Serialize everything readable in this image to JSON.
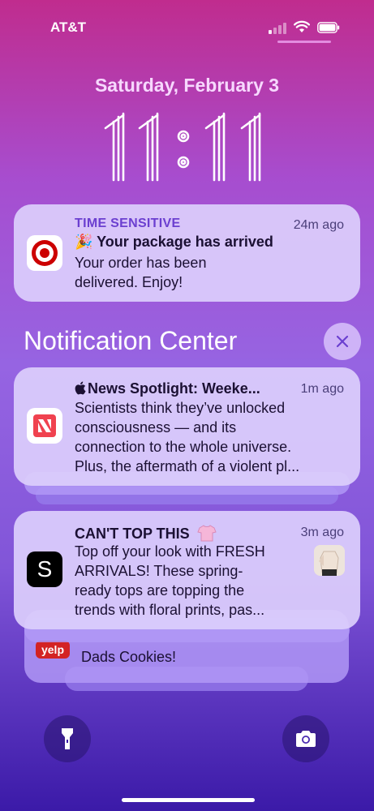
{
  "status": {
    "carrier": "AT&T"
  },
  "lock": {
    "date": "Saturday, February 3"
  },
  "time_sensitive": {
    "label": "TIME SENSITIVE",
    "time": "24m ago",
    "title": "🎉 Your package has arrived",
    "body_line1": "Your order has been",
    "body_line2": "delivered. Enjoy!"
  },
  "notification_center": {
    "title": "Notification Center"
  },
  "news": {
    "title": "News Spotlight: Weeke...",
    "time": "1m ago",
    "body_line1": "Scientists think they’ve unlocked",
    "body_line2": "consciousness — and its",
    "body_line3": "connection to the whole universe.",
    "body_line4": "Plus, the aftermath of a violent pl..."
  },
  "shop": {
    "title": "CAN'T TOP THIS",
    "time": "3m ago",
    "icon_letter": "S",
    "body_line1": "Top off your look with FRESH",
    "body_line2": "ARRIVALS! These spring-",
    "body_line3": "ready tops are topping the",
    "body_line4": "trends with floral prints, pas..."
  },
  "yelp": {
    "icon_label": "yelp",
    "body": "Dads Cookies!"
  },
  "icons": {
    "flashlight": "flashlight-icon",
    "camera": "camera-icon",
    "close": "close-icon"
  },
  "colors": {
    "accent": "#6b3fd0",
    "target_red": "#cc0000",
    "news_red": "#f0424f",
    "yelp_red": "#d32323"
  }
}
